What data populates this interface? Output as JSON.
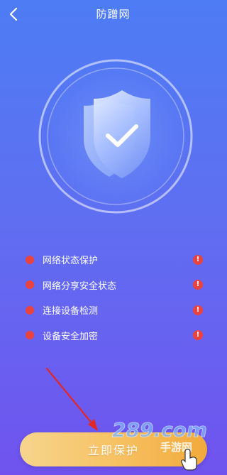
{
  "header": {
    "title": "防蹭网",
    "back_icon": "chevron-left-icon"
  },
  "shield": {
    "icon": "shield-check-icon"
  },
  "status_items": [
    {
      "label": "网络状态保护",
      "dot_color": "#e8433f",
      "alert_icon": "exclamation-icon",
      "alert_glyph": "!"
    },
    {
      "label": "网络分享安全状态",
      "dot_color": "#e8433f",
      "alert_icon": "exclamation-icon",
      "alert_glyph": "!"
    },
    {
      "label": "连接设备检测",
      "dot_color": "#e8433f",
      "alert_icon": "exclamation-icon",
      "alert_glyph": "!"
    },
    {
      "label": "设备安全加密",
      "dot_color": "#e8433f",
      "alert_icon": "exclamation-icon",
      "alert_glyph": "!"
    }
  ],
  "action": {
    "protect_label": "立即保护"
  },
  "watermark": {
    "text": "289.com",
    "subtext": "手游网"
  },
  "colors": {
    "bg_top": "#4d7cf4",
    "bg_bottom": "#7053ee",
    "alert_red": "#e8433f",
    "button_gold": "#f7c264",
    "annotation_red": "#e0282a"
  }
}
